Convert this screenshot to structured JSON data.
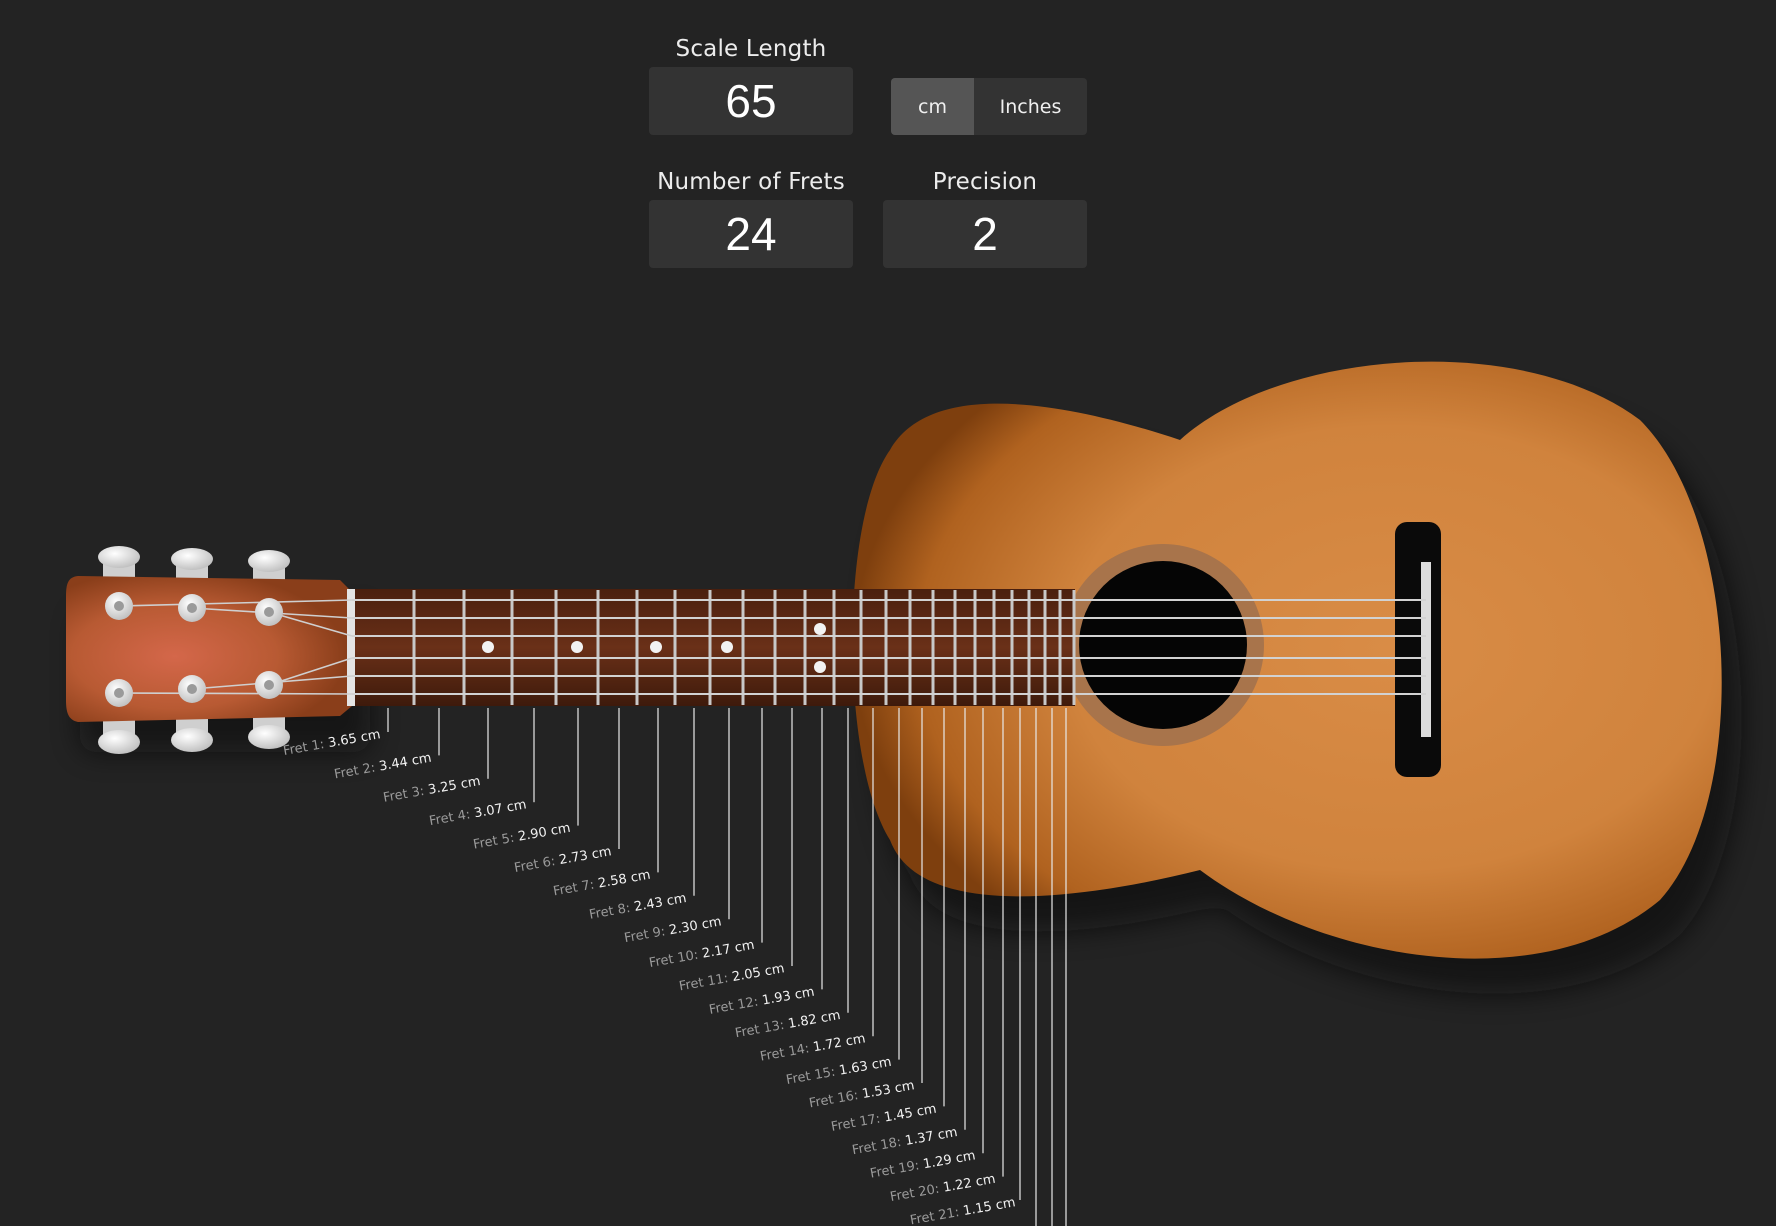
{
  "controls": {
    "scale_length": {
      "label": "Scale Length",
      "value": "65"
    },
    "units": {
      "options": [
        "cm",
        "Inches"
      ],
      "selected": "cm"
    },
    "number_of_frets": {
      "label": "Number of Frets",
      "value": "24"
    },
    "precision": {
      "label": "Precision",
      "value": "2"
    }
  },
  "frets": [
    {
      "label": "Fret 1:",
      "value": "3.65 cm"
    },
    {
      "label": "Fret 2:",
      "value": "3.44 cm"
    },
    {
      "label": "Fret 3:",
      "value": "3.25 cm"
    },
    {
      "label": "Fret 4:",
      "value": "3.07 cm"
    },
    {
      "label": "Fret 5:",
      "value": "2.90 cm"
    },
    {
      "label": "Fret 6:",
      "value": "2.73 cm"
    },
    {
      "label": "Fret 7:",
      "value": "2.58 cm"
    },
    {
      "label": "Fret 8:",
      "value": "2.43 cm"
    },
    {
      "label": "Fret 9:",
      "value": "2.30 cm"
    },
    {
      "label": "Fret 10:",
      "value": "2.17 cm"
    },
    {
      "label": "Fret 11:",
      "value": "2.05 cm"
    },
    {
      "label": "Fret 12:",
      "value": "1.93 cm"
    },
    {
      "label": "Fret 13:",
      "value": "1.82 cm"
    },
    {
      "label": "Fret 14:",
      "value": "1.72 cm"
    },
    {
      "label": "Fret 15:",
      "value": "1.63 cm"
    },
    {
      "label": "Fret 16:",
      "value": "1.53 cm"
    },
    {
      "label": "Fret 17:",
      "value": "1.45 cm"
    },
    {
      "label": "Fret 18:",
      "value": "1.37 cm"
    },
    {
      "label": "Fret 19:",
      "value": "1.29 cm"
    },
    {
      "label": "Fret 20:",
      "value": "1.22 cm"
    },
    {
      "label": "Fret 21:",
      "value": "1.15 cm"
    }
  ],
  "colors": {
    "background": "#232323",
    "control_bg": "#333333",
    "toggle_active": "#555555",
    "body_light": "#d58a44",
    "body_dark": "#8a4a12",
    "fretboard": "#5a2a14",
    "headstock": "#c0562a",
    "fret_wire": "#c9c9c9",
    "string": "#cfcfcf",
    "tuner": "#e8e8e8"
  }
}
